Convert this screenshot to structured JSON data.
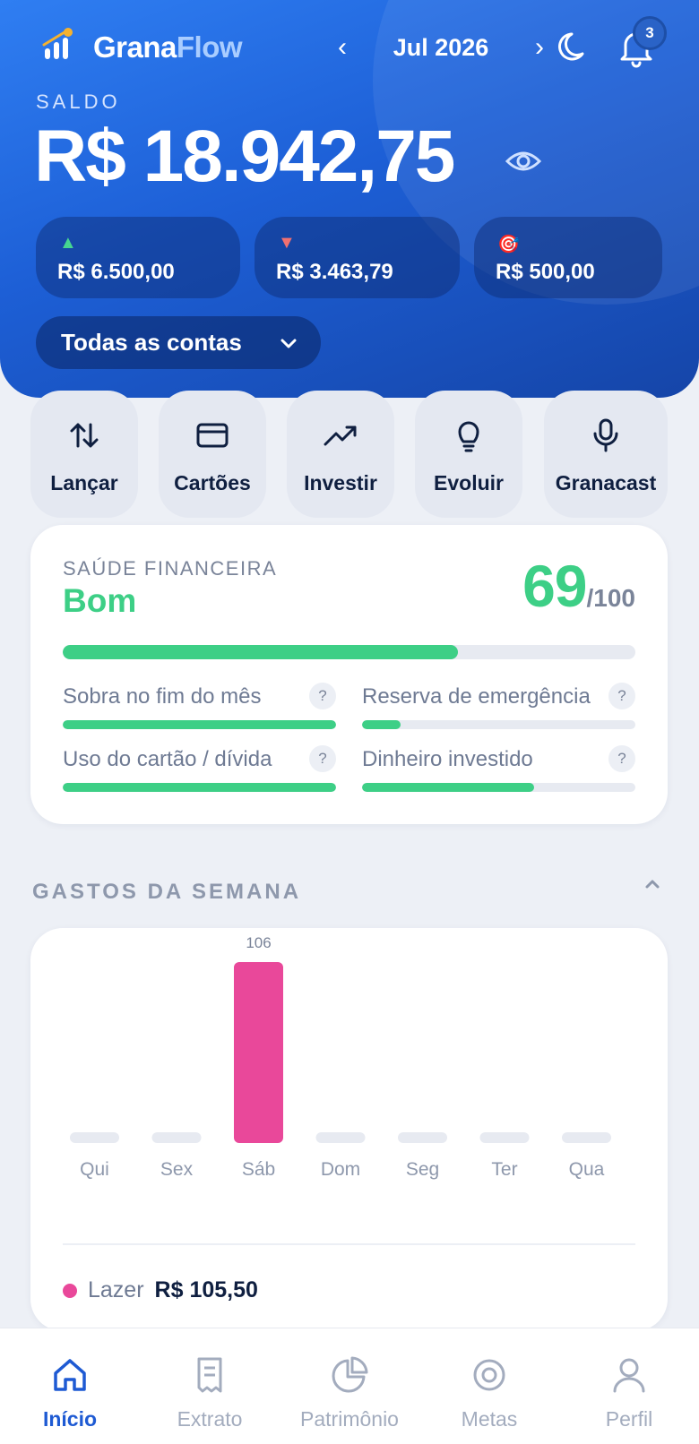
{
  "app": {
    "name_part1": "Grana",
    "name_part2": "Flow"
  },
  "header": {
    "month": "Jul 2026",
    "prev_symbol": "‹",
    "next_symbol": "›",
    "notifications_count": "3",
    "balance_label": "SALDO",
    "balance_value": "R$ 18.942,75",
    "summary": [
      {
        "icon": "▲",
        "value": "R$ 6.500,00"
      },
      {
        "icon": "▼",
        "value": "R$ 3.463,79"
      },
      {
        "icon": "🎯",
        "value": "R$ 500,00"
      }
    ],
    "account_selector": "Todas as contas"
  },
  "quick_actions": [
    {
      "label": "Lançar",
      "icon": "arrows-up-down-icon"
    },
    {
      "label": "Cartões",
      "icon": "credit-card-icon"
    },
    {
      "label": "Investir",
      "icon": "trending-up-icon"
    },
    {
      "label": "Evoluir",
      "icon": "lightbulb-icon"
    },
    {
      "label": "Granacast",
      "icon": "microphone-icon"
    }
  ],
  "health": {
    "title": "SAÚDE FINANCEIRA",
    "status": "Bom",
    "score": "69",
    "score_max": "/100",
    "score_fraction": 0.69,
    "metrics": [
      {
        "label": "Sobra no fim do mês",
        "fraction": 1.0
      },
      {
        "label": "Reserva de emergência",
        "fraction": 0.14
      },
      {
        "label": "Uso do cartão / dívida",
        "fraction": 1.0
      },
      {
        "label": "Dinheiro investido",
        "fraction": 0.63
      }
    ],
    "help_symbol": "?"
  },
  "weekly": {
    "title": "GASTOS DA SEMANA",
    "legend": [
      {
        "name": "Lazer",
        "value": "R$ 105,50",
        "color": "#e9489a"
      }
    ]
  },
  "chart_data": {
    "type": "bar",
    "categories": [
      "Qui",
      "Sex",
      "Sáb",
      "Dom",
      "Seg",
      "Ter",
      "Qua"
    ],
    "values": [
      0,
      0,
      106,
      0,
      0,
      0,
      0
    ],
    "data_labels": [
      "",
      "",
      "106",
      "",
      "",
      "",
      ""
    ],
    "colors": {
      "bar": "#e9489a",
      "empty": "#e7eaf1"
    },
    "ylim": [
      0,
      106
    ],
    "grid": false
  },
  "nav": [
    {
      "label": "Início",
      "icon": "home-icon",
      "active": true
    },
    {
      "label": "Extrato",
      "icon": "receipt-icon",
      "active": false
    },
    {
      "label": "Patrimônio",
      "icon": "pie-chart-icon",
      "active": false
    },
    {
      "label": "Metas",
      "icon": "target-icon",
      "active": false
    },
    {
      "label": "Perfil",
      "icon": "user-icon",
      "active": false
    }
  ],
  "colors": {
    "primary": "#1e5ad3",
    "success": "#3dcf86",
    "accent": "#e9489a"
  }
}
